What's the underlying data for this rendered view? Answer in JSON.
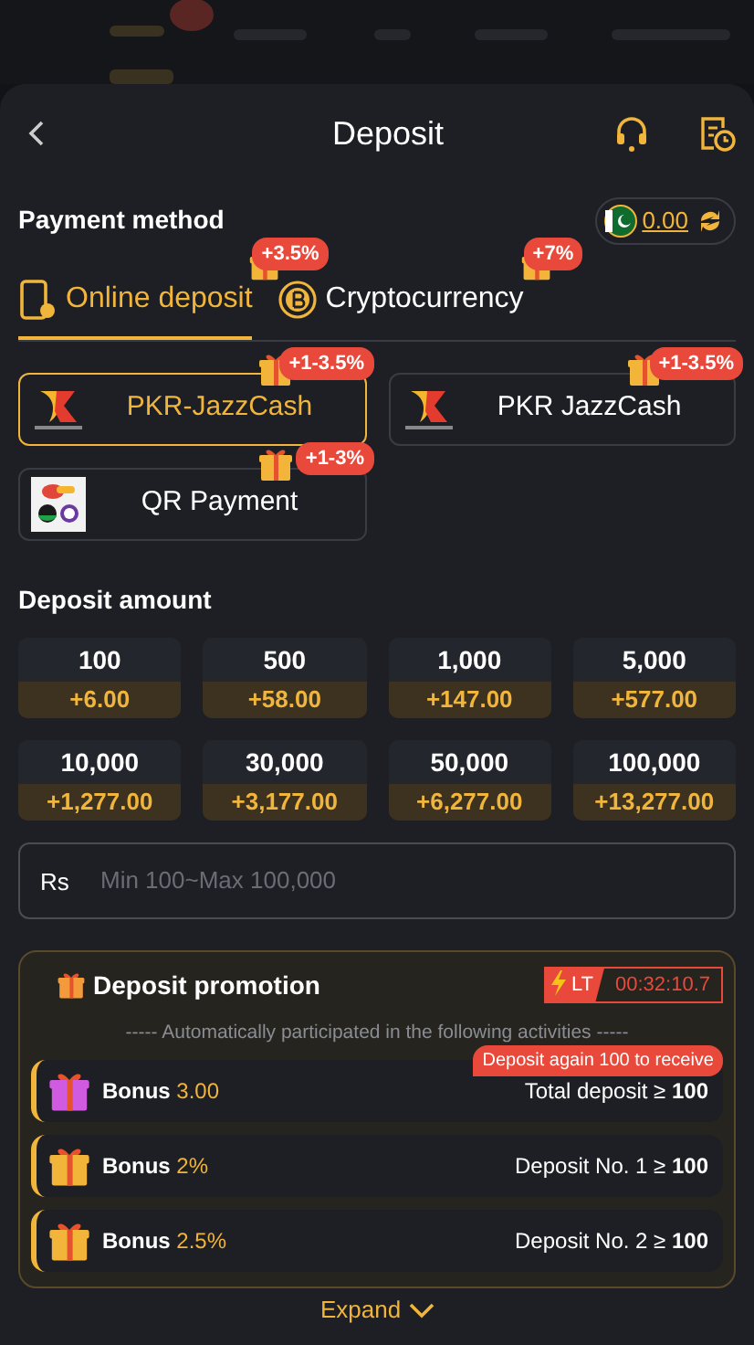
{
  "header": {
    "title": "Deposit"
  },
  "payment": {
    "title": "Payment method",
    "balance": "0.00",
    "tabs": [
      {
        "label": "Online deposit",
        "badge": "+3.5%",
        "selected": true
      },
      {
        "label": "Cryptocurrency",
        "badge": "+7%",
        "selected": false
      }
    ],
    "methods": [
      {
        "label": "PKR-JazzCash",
        "badge": "+1-3.5%",
        "kind": "jazzcash",
        "selected": true
      },
      {
        "label": "PKR JazzCash",
        "badge": "+1-3.5%",
        "kind": "jazzcash",
        "selected": false
      },
      {
        "label": "QR Payment",
        "badge": "+1-3%",
        "kind": "qr",
        "selected": false
      }
    ]
  },
  "amount": {
    "title": "Deposit amount",
    "options": [
      {
        "value": "100",
        "bonus": "+6.00"
      },
      {
        "value": "500",
        "bonus": "+58.00"
      },
      {
        "value": "1,000",
        "bonus": "+147.00"
      },
      {
        "value": "5,000",
        "bonus": "+577.00"
      },
      {
        "value": "10,000",
        "bonus": "+1,277.00"
      },
      {
        "value": "30,000",
        "bonus": "+3,177.00"
      },
      {
        "value": "50,000",
        "bonus": "+6,277.00"
      },
      {
        "value": "100,000",
        "bonus": "+13,277.00"
      }
    ],
    "currency": "Rs",
    "placeholder": "Min 100~Max 100,000"
  },
  "promotion": {
    "title": "Deposit promotion",
    "timer_tag": "LT",
    "timer": "00:32:10.7",
    "subtitle": "----- Automatically participated in the following activities -----",
    "items": [
      {
        "label": "Bonus",
        "value": "3.00",
        "condition": "Total deposit ≥ **100**",
        "note": "Deposit again 100 to receive",
        "color": "#d05ae0"
      },
      {
        "label": "Bonus",
        "value": "2%",
        "condition": "Deposit No. 1 ≥ **100**",
        "color": "#f3b43a"
      },
      {
        "label": "Bonus",
        "value": "2.5%",
        "condition": "Deposit No. 2 ≥ **100**",
        "color": "#f3b43a"
      }
    ],
    "expand": "Expand"
  }
}
